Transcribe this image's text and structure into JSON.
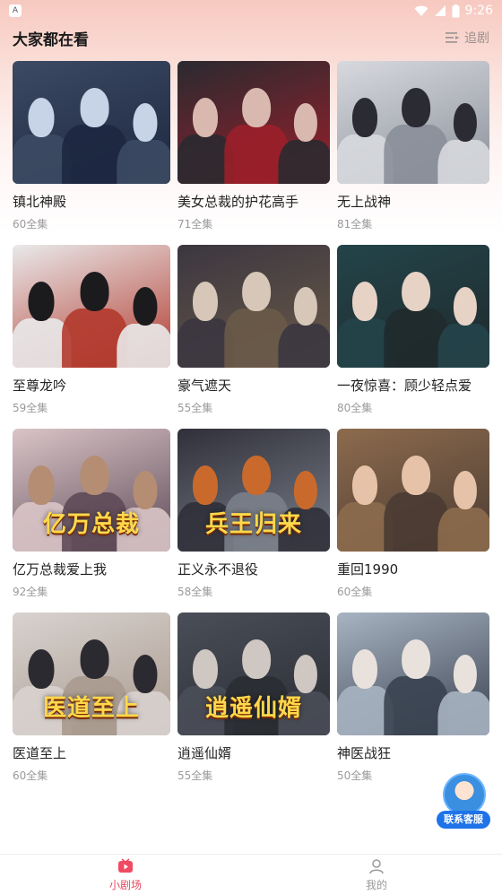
{
  "status_bar": {
    "app_icon_letter": "A",
    "time": "9:26",
    "icons": [
      "wifi-icon",
      "signal-icon",
      "battery-icon"
    ]
  },
  "header": {
    "title": "大家都在看",
    "follow_label": "追剧",
    "follow_icon": "list-icon"
  },
  "dramas": [
    {
      "title": "镇北神殿",
      "episodes": "60全集",
      "caption": "",
      "palette": [
        "#3c4a63",
        "#c7d3e6",
        "#1d2740"
      ]
    },
    {
      "title": "美女总裁的护花高手",
      "episodes": "71全集",
      "caption": "",
      "palette": [
        "#2a2a30",
        "#d9b8b0",
        "#9a1f2a"
      ]
    },
    {
      "title": "无上战神",
      "episodes": "81全集",
      "caption": "",
      "palette": [
        "#d7d9de",
        "#2b2b33",
        "#8a8f99"
      ]
    },
    {
      "title": "至尊龙吟",
      "episodes": "59全集",
      "caption": "",
      "palette": [
        "#e9e9ea",
        "#1b1b1e",
        "#b23a2e"
      ]
    },
    {
      "title": "豪气遮天",
      "episodes": "55全集",
      "caption": "",
      "palette": [
        "#3b3640",
        "#d6c7b8",
        "#6a5a48"
      ]
    },
    {
      "title": "一夜惊喜：顾少轻点爱",
      "episodes": "80全集",
      "caption": "",
      "palette": [
        "#23444a",
        "#e7d2c6",
        "#1f2a2c"
      ]
    },
    {
      "title": "亿万总裁爱上我",
      "episodes": "92全集",
      "caption": "亿万总裁",
      "palette": [
        "#d9c4c7",
        "#b58d72",
        "#5e4a57"
      ]
    },
    {
      "title": "正义永不退役",
      "episodes": "58全集",
      "caption": "兵王归来",
      "palette": [
        "#30303a",
        "#c96a2c",
        "#7a7f8a"
      ]
    },
    {
      "title": "重回1990",
      "episodes": "60全集",
      "caption": "",
      "palette": [
        "#8d6b4d",
        "#e6c3a8",
        "#4a3b33"
      ]
    },
    {
      "title": "医道至上",
      "episodes": "60全集",
      "caption": "医道至上",
      "palette": [
        "#d8d2cf",
        "#2b2a30",
        "#a99a8e"
      ]
    },
    {
      "title": "逍遥仙婿",
      "episodes": "55全集",
      "caption": "逍遥仙婿",
      "palette": [
        "#4a4e58",
        "#cfc7c2",
        "#2a2d33"
      ]
    },
    {
      "title": "神医战狂",
      "episodes": "50全集",
      "caption": "",
      "palette": [
        "#a8b4c2",
        "#e9e2dc",
        "#3a4250"
      ]
    }
  ],
  "floating_service": {
    "label": "联系客服",
    "icon": "customer-service-avatar"
  },
  "tab_bar": {
    "tabs": [
      {
        "label": "小剧场",
        "icon": "play-tv-icon",
        "active": true
      },
      {
        "label": "我的",
        "icon": "user-icon",
        "active": false
      }
    ],
    "active_color": "#e94a5f",
    "inactive_color": "#9a9a9a"
  }
}
